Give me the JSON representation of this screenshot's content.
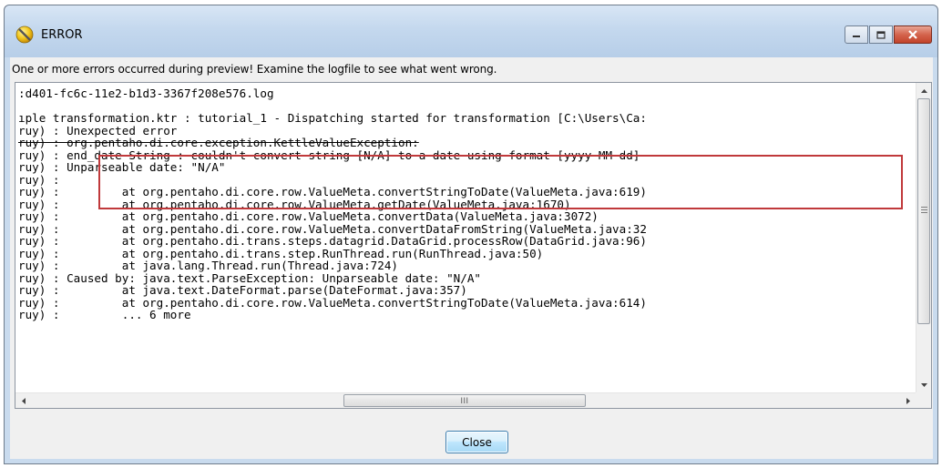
{
  "window": {
    "title": "ERROR",
    "icon": "warning-circle-icon",
    "caption_buttons": [
      "minimize-icon",
      "maximize-icon",
      "close-icon"
    ]
  },
  "dialog": {
    "message": "One or more errors occurred during preview!  Examine the logfile to see what went wrong.",
    "close_label": "Close"
  },
  "log": {
    "lines": [
      ":d401-fc6c-11e2-b1d3-3367f208e576.log",
      "",
      "ıple transformation.ktr : tutorial_1 - Dispatching started for transformation [C:\\Users\\Ca:",
      "ruy) : Unexpected error",
      "ruy) : org.pentaho.di.core.exception.KettleValueException:",
      "ruy) : end_date String : couldn't convert string [N/A] to a date using format [yyyy-MM-dd]",
      "ruy) : Unparseable date: \"N/A\"",
      "ruy) :",
      "ruy) :         at org.pentaho.di.core.row.ValueMeta.convertStringToDate(ValueMeta.java:619)",
      "ruy) :         at org.pentaho.di.core.row.ValueMeta.getDate(ValueMeta.java:1670)",
      "ruy) :         at org.pentaho.di.core.row.ValueMeta.convertData(ValueMeta.java:3072)",
      "ruy) :         at org.pentaho.di.core.row.ValueMeta.convertDataFromString(ValueMeta.java:32",
      "ruy) :         at org.pentaho.di.trans.steps.datagrid.DataGrid.processRow(DataGrid.java:96)",
      "ruy) :         at org.pentaho.di.trans.step.RunThread.run(RunThread.java:50)",
      "ruy) :         at java.lang.Thread.run(Thread.java:724)",
      "ruy) : Caused by: java.text.ParseException: Unparseable date: \"N/A\"",
      "ruy) :         at java.text.DateFormat.parse(DateFormat.java:357)",
      "ruy) :         at org.pentaho.di.core.row.ValueMeta.convertStringToDate(ValueMeta.java:614)",
      "ruy) :         ... 6 more"
    ],
    "struck_line_index": 4,
    "highlight_color": "#c0393b"
  },
  "scrollbars": {
    "horizontal_grip": "III"
  }
}
